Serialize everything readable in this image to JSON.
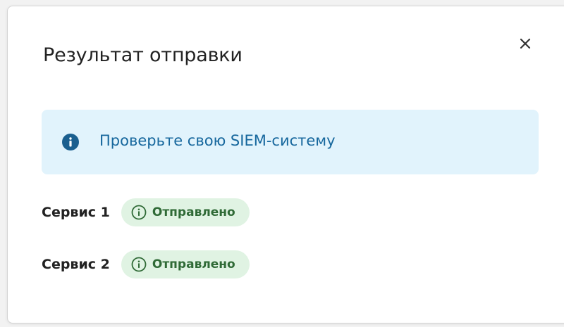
{
  "dialog": {
    "title": "Результат отправки",
    "close_icon": "close-icon"
  },
  "info_box": {
    "icon": "info-icon",
    "message": "Проверьте свою SIEM-систему"
  },
  "services": [
    {
      "label": "Сервис 1",
      "status": "Отправлено",
      "status_icon": "info-outline-icon"
    },
    {
      "label": "Сервис 2",
      "status": "Отправлено",
      "status_icon": "info-outline-icon"
    }
  ],
  "colors": {
    "info_background": "#e1f3fc",
    "info_text": "#16679d",
    "info_icon": "#1a5f8f",
    "badge_background": "#e0f3e3",
    "badge_text": "#2f6a36"
  }
}
